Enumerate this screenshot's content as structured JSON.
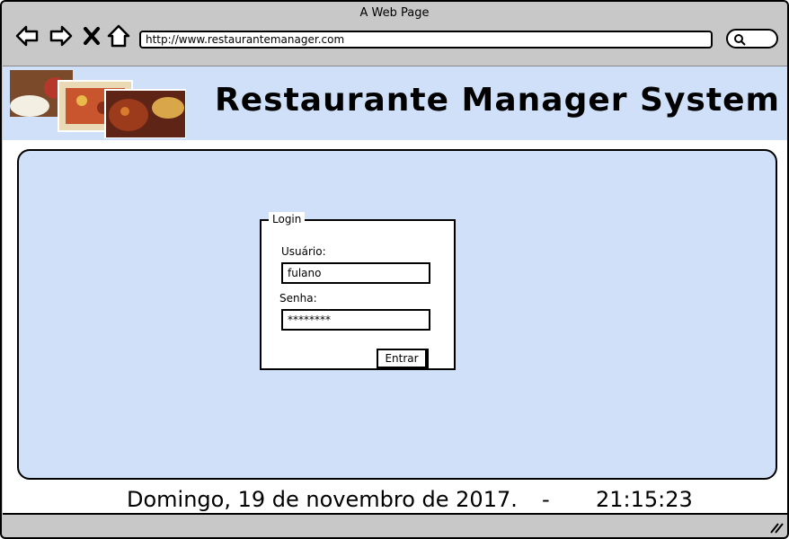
{
  "window": {
    "title": "A Web Page"
  },
  "browser": {
    "url": "http://www.restaurantemanager.com",
    "icons": [
      "back-icon",
      "forward-icon",
      "close-icon",
      "home-icon",
      "search-icon"
    ]
  },
  "header": {
    "title": "Restaurante Manager System"
  },
  "login": {
    "legend": "Login",
    "username_label": "Usuário:",
    "username_value": "fulano",
    "password_label": "Senha:",
    "password_value": "********",
    "submit_label": "Entrar"
  },
  "footer": {
    "date": "Domingo, 19 de novembro de 2017.",
    "separator": "-",
    "time": "21:15:23"
  },
  "colors": {
    "panel": "#cfe0f8",
    "chrome": "#c8c8c8",
    "border": "#000000"
  }
}
